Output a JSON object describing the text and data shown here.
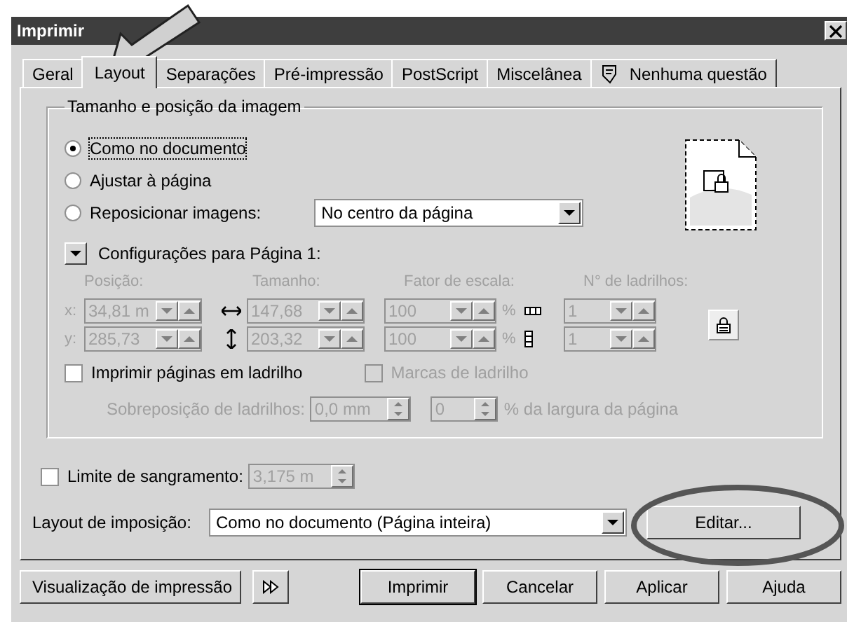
{
  "window": {
    "title": "Imprimir"
  },
  "tabs": [
    {
      "label": "Geral",
      "selected": false,
      "kind": "plain"
    },
    {
      "label": "Layout",
      "selected": true,
      "kind": "plain"
    },
    {
      "label": "Separações",
      "selected": false,
      "kind": "plain"
    },
    {
      "label": "Pré-impressão",
      "selected": false,
      "kind": "plain"
    },
    {
      "label": "PostScript",
      "selected": false,
      "kind": "plain"
    },
    {
      "label": "Miscelânea",
      "selected": false,
      "kind": "plain"
    },
    {
      "label": "Nenhuma questão",
      "selected": false,
      "kind": "status"
    }
  ],
  "image_group": {
    "title": "Tamanho e posição da imagem",
    "options": [
      {
        "label": "Como no documento",
        "selected": true
      },
      {
        "label": "Ajustar à página",
        "selected": false
      },
      {
        "label": "Reposicionar imagens:",
        "selected": false
      }
    ],
    "reposition_select": {
      "value": "No centro da página"
    },
    "page_settings": {
      "label": "Configurações para Página 1:",
      "expanded": true
    },
    "grid_disabled": true,
    "position": {
      "heading": "Posição:",
      "rows": [
        {
          "axis": "x:",
          "value": "34,81 m"
        },
        {
          "axis": "y:",
          "value": "285,73"
        }
      ]
    },
    "size": {
      "heading": "Tamanho:",
      "values": [
        "147,68",
        "203,32"
      ]
    },
    "scale": {
      "heading": "Fator de escala:",
      "rows": [
        {
          "value": "100",
          "unit": "%"
        },
        {
          "value": "100",
          "unit": "%"
        }
      ]
    },
    "tiles": {
      "heading": "N° de ladrilhos:",
      "values": [
        "1",
        "1"
      ]
    },
    "tile_pages": {
      "label": "Imprimir páginas em ladrilho",
      "checked": false
    },
    "tile_marks": {
      "label": "Marcas de ladrilho",
      "checked": false,
      "disabled": true
    },
    "overlap": {
      "label": "Sobreposição de ladrilhos:",
      "value": "0,0 mm",
      "percent_value": "0",
      "suffix": "% da largura da página",
      "disabled": true
    }
  },
  "bleed": {
    "label": "Limite de sangramento:",
    "checked": false,
    "value": "3,175 m",
    "disabled": true
  },
  "imposition": {
    "label": "Layout de imposição:",
    "value": "Como no documento (Página inteira)",
    "edit_button": "Editar..."
  },
  "footer": {
    "preview_button": "Visualização de impressão",
    "buttons": [
      {
        "label": "Imprimir",
        "default": true
      },
      {
        "label": "Cancelar",
        "default": false
      },
      {
        "label": "Aplicar",
        "default": false
      },
      {
        "label": "Ajuda",
        "default": false
      }
    ]
  }
}
